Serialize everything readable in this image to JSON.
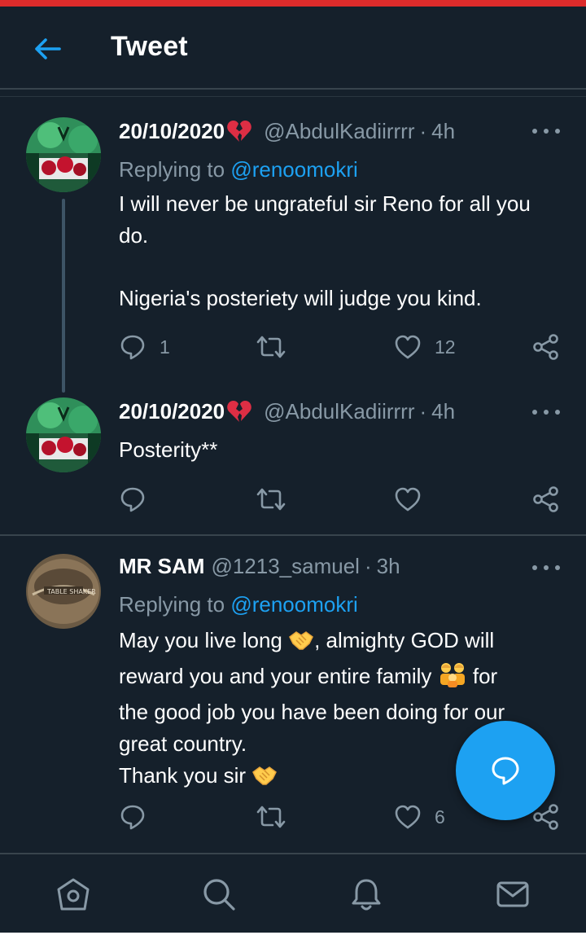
{
  "header": {
    "title": "Tweet",
    "back_icon": "arrow-left-icon",
    "accent": "#1da1f2"
  },
  "tweets": [
    {
      "name": "20/10/2020",
      "name_emoji": "broken-heart",
      "handle": "@AbdulKadiirrrr",
      "dot": "·",
      "time": "4h",
      "replying_prefix": "Replying to ",
      "replying_to": "@renoomokri",
      "text_lines": [
        "I will never be ungrateful sir Reno for all you",
        "do.",
        "",
        "Nigeria's posteriety will judge you kind."
      ],
      "replies": "1",
      "retweets": "",
      "likes": "12"
    },
    {
      "name": "20/10/2020",
      "name_emoji": "broken-heart",
      "handle": "@AbdulKadiirrrr",
      "dot": "·",
      "time": "4h",
      "text_lines": [
        "Posterity**"
      ],
      "replies": "",
      "retweets": "",
      "likes": ""
    },
    {
      "name": "MR SAM",
      "handle": "@1213_samuel",
      "dot": "·",
      "time": "3h",
      "replying_prefix": "Replying to ",
      "replying_to": "@renoomokri",
      "text_line1_a": "May you live long ",
      "text_line1_b": ", almighty GOD will",
      "text_line2_a": "reward you and your entire family ",
      "text_line2_b": " for",
      "text_line3": "the good job you have been doing for our",
      "text_line4": "great country.",
      "text_line5": "Thank you sir ",
      "replies": "",
      "retweets": "",
      "likes": "6"
    }
  ],
  "fab": {
    "icon": "compose-reply-icon"
  },
  "bottom_nav": [
    "home-icon",
    "search-icon",
    "notifications-icon",
    "messages-icon"
  ],
  "colors": {
    "background": "#15202b",
    "secondary_text": "#8899a6",
    "divider": "#38444d",
    "top_strip": "#dd2b2b"
  }
}
